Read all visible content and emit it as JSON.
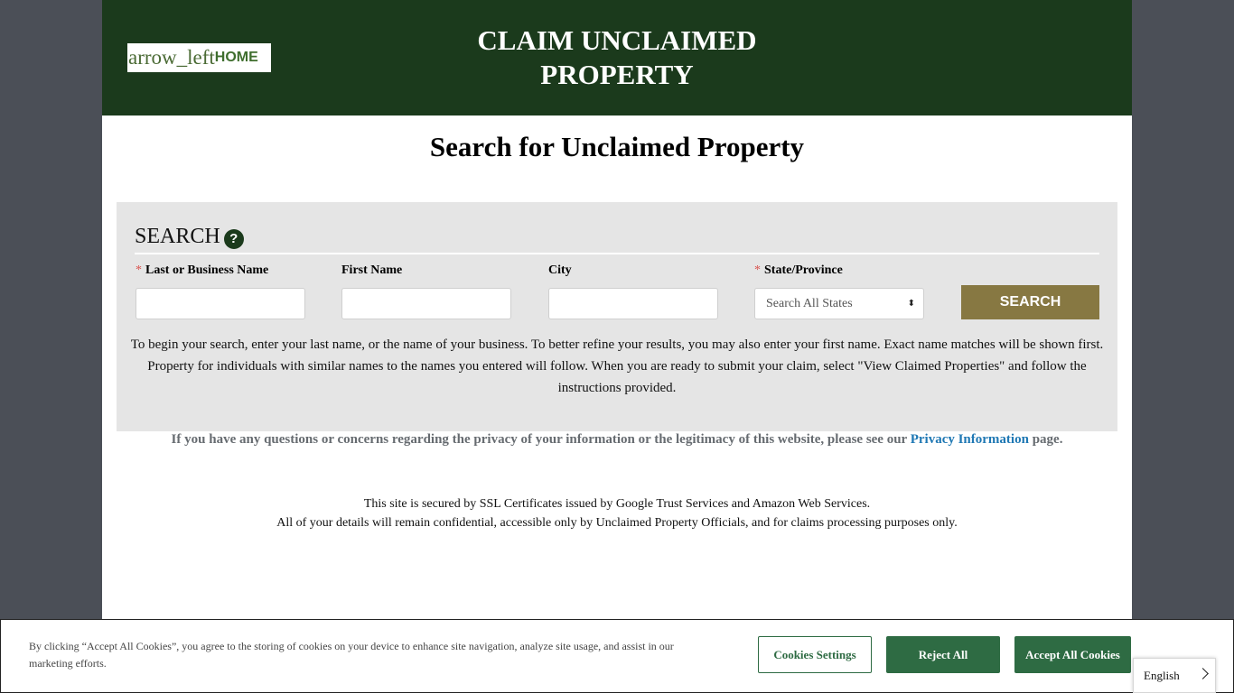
{
  "header": {
    "home_icon": "arrow_left",
    "home_label": "HOME",
    "title": "CLAIM UNCLAIMED PROPERTY"
  },
  "main": {
    "title": "Search for Unclaimed Property"
  },
  "search": {
    "heading": "SEARCH",
    "help_icon": "?",
    "required_marker": "*",
    "fields": {
      "last_name": {
        "label": "Last or Business Name",
        "value": ""
      },
      "first_name": {
        "label": "First Name",
        "value": ""
      },
      "city": {
        "label": "City",
        "value": ""
      },
      "state": {
        "label": "State/Province",
        "selected": "Search All States"
      }
    },
    "button_label": "SEARCH",
    "instructions": "To begin your search, enter your last name, or the name of your business.  To better refine your results, you may also enter your first name.  Exact name matches will be shown first.  Property for individuals with similar names to the names you entered will follow.  When you are ready to submit your claim, select \"View Claimed Properties\" and follow the instructions provided."
  },
  "privacy": {
    "text_before": "If you have any questions or concerns regarding the privacy of your information or the legitimacy of this website, please see our ",
    "link_label": "Privacy Information",
    "text_after": " page."
  },
  "ssl": {
    "line1": "This site is secured by SSL Certificates issued by Google Trust Services and Amazon Web Services.",
    "line2": "All of your details will remain confidential, accessible only by Unclaimed Property Officials, and for claims processing purposes only."
  },
  "cookie_banner": {
    "text": "By clicking “Accept All Cookies”, you agree to the storing of cookies on your device to enhance site navigation, analyze site usage, and assist in our marketing efforts.",
    "settings_label": "Cookies Settings",
    "reject_label": "Reject All",
    "accept_label": "Accept All Cookies"
  },
  "language": {
    "selected": "English",
    "icon": "chevron-right-icon"
  },
  "colors": {
    "header_bg": "#1b3a1c",
    "search_button": "#877842",
    "cookie_button": "#2e6b43",
    "page_side_bg": "#4b4f57",
    "link": "#1f78b4"
  }
}
